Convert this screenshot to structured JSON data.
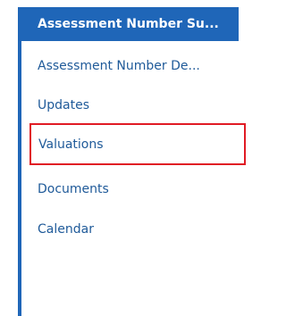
{
  "nav": {
    "items": [
      {
        "label": "Assessment Number Su..."
      },
      {
        "label": "Assessment Number De..."
      },
      {
        "label": "Updates"
      },
      {
        "label": "Valuations"
      },
      {
        "label": "Documents"
      },
      {
        "label": "Calendar"
      }
    ],
    "colors": {
      "accent": "#1f66b8",
      "link": "#1f5a99",
      "highlight_border": "#e01b24"
    }
  }
}
